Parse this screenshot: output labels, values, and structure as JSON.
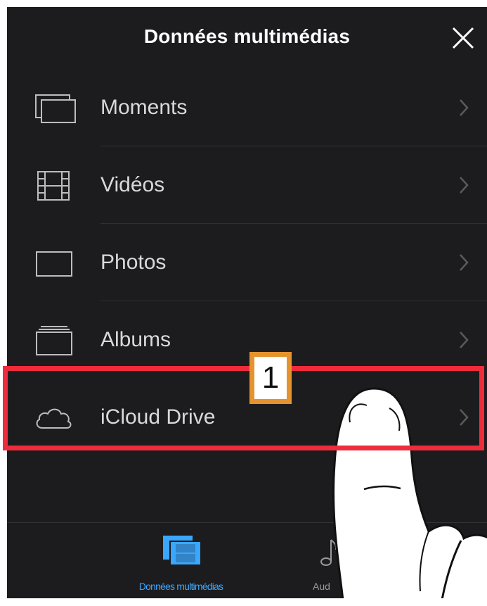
{
  "header": {
    "title": "Données multimédias",
    "close_icon": "close-icon"
  },
  "menu": {
    "items": [
      {
        "label": "Moments",
        "icon": "moments-icon"
      },
      {
        "label": "Vidéos",
        "icon": "film-icon"
      },
      {
        "label": "Photos",
        "icon": "photo-icon"
      },
      {
        "label": "Albums",
        "icon": "album-stack-icon"
      },
      {
        "label": "iCloud Drive",
        "icon": "cloud-icon"
      }
    ]
  },
  "annotation": {
    "step_number": "1",
    "highlight_color": "#ef2c3c",
    "badge_border_color": "#e4932e"
  },
  "tabbar": {
    "tabs": [
      {
        "label": "Données multimédias",
        "icon": "media-film-icon",
        "active": true
      },
      {
        "label": "Aud",
        "icon": "music-note-icon",
        "active": false
      }
    ]
  },
  "colors": {
    "background": "#1c1c1e",
    "accent": "#3aa7ff",
    "text": "#d9d9d9"
  }
}
